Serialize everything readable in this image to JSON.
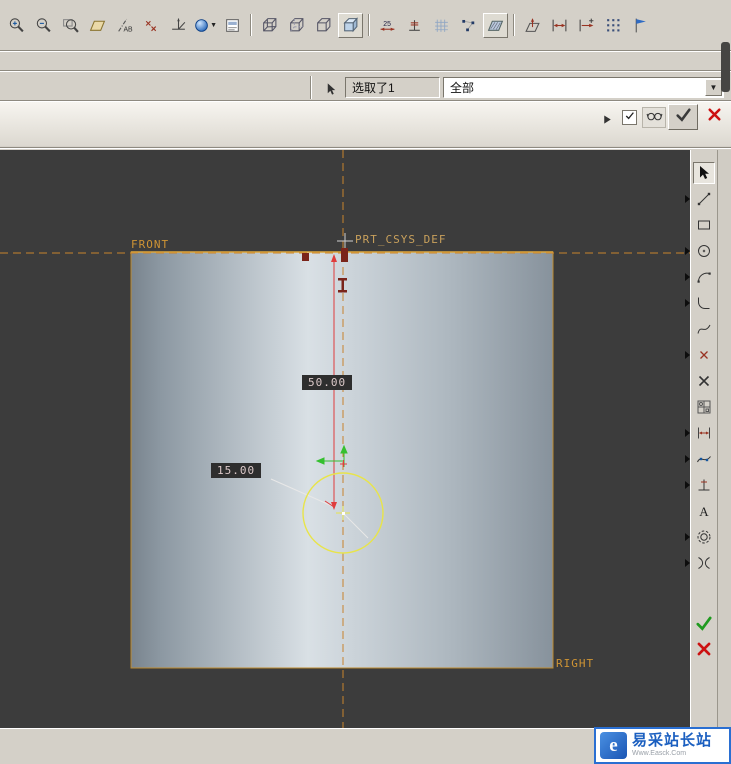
{
  "app": {
    "name": "sketcher-window",
    "canvas_bg": "#3c3c3c"
  },
  "colors": {
    "datum_orange": "#c8832c",
    "centerline_red": "#e03c3c",
    "sketch_yellow": "#e8e44a",
    "reference_green": "#35c02f",
    "accept_green": "#1f9a1f",
    "cancel_red": "#cc1111",
    "watermark_blue": "#1b5fc0",
    "toolbar_gray": "#d4d0c8"
  },
  "top_toolbar": {
    "buttons": [
      {
        "icon": "zoom-in-icon"
      },
      {
        "icon": "zoom-out-icon"
      },
      {
        "icon": "zoom-fit-icon"
      },
      {
        "icon": "datum-plane-icon"
      },
      {
        "icon": "datum-axis-icon"
      },
      {
        "icon": "datum-point-icon"
      },
      {
        "icon": "datum-csys-icon"
      },
      {
        "icon": "shaded-sphere-icon",
        "dropdown": true
      },
      {
        "icon": "page-icon"
      },
      {
        "sep": true
      },
      {
        "icon": "cube-wireframe-icon"
      },
      {
        "icon": "cube-hiddenline-icon"
      },
      {
        "icon": "cube-nohidden-icon"
      },
      {
        "icon": "cube-shaded-icon",
        "framed": true
      },
      {
        "sep": true
      },
      {
        "icon": "dim-display-icon"
      },
      {
        "icon": "constraint-display-icon"
      },
      {
        "icon": "grid-display-icon"
      },
      {
        "icon": "vertex-display-icon"
      },
      {
        "icon": "section-shade-icon",
        "framed": true
      },
      {
        "sep": true
      },
      {
        "icon": "sketch-orient-icon"
      },
      {
        "icon": "snap-fit-icon"
      },
      {
        "icon": "snap-ref-icon"
      },
      {
        "icon": "pattern-grid-icon"
      },
      {
        "icon": "flag-icon"
      }
    ]
  },
  "status_bar": {
    "selection_text": "选取了1",
    "filter_value": "全部"
  },
  "dashboard": {
    "checkbox_checked": true
  },
  "right_toolbar": {
    "buttons": [
      {
        "icon": "select-arrow-icon",
        "active": true
      },
      {
        "icon": "line-icon",
        "flyout": true
      },
      {
        "icon": "rectangle-icon"
      },
      {
        "icon": "circle-icon",
        "flyout": true
      },
      {
        "icon": "arc-icon",
        "flyout": true
      },
      {
        "icon": "fillet-icon",
        "flyout": true
      },
      {
        "icon": "spline-icon"
      },
      {
        "icon": "point-icon",
        "flyout": true
      },
      {
        "icon": "delete-icon"
      },
      {
        "icon": "palette-icon"
      },
      {
        "icon": "dimension-icon",
        "flyout": true
      },
      {
        "icon": "modify-icon",
        "flyout": true
      },
      {
        "icon": "constraint-icon",
        "flyout": true
      },
      {
        "icon": "text-icon"
      },
      {
        "icon": "offset-icon",
        "flyout": true
      },
      {
        "icon": "trim-icon",
        "flyout": true
      }
    ],
    "done_icon": "done-check-icon",
    "quit_icon": "quit-x-icon"
  },
  "canvas": {
    "labels": {
      "front": "FRONT",
      "csys": "PRT_CSYS_DEF",
      "right": "RIGHT"
    },
    "dims": {
      "vertical": "50.00",
      "horizontal": "15.00"
    }
  },
  "watermark": {
    "logo_letter": "e",
    "title": "易采站长站",
    "subtitle": "Www.Easck.Com"
  }
}
